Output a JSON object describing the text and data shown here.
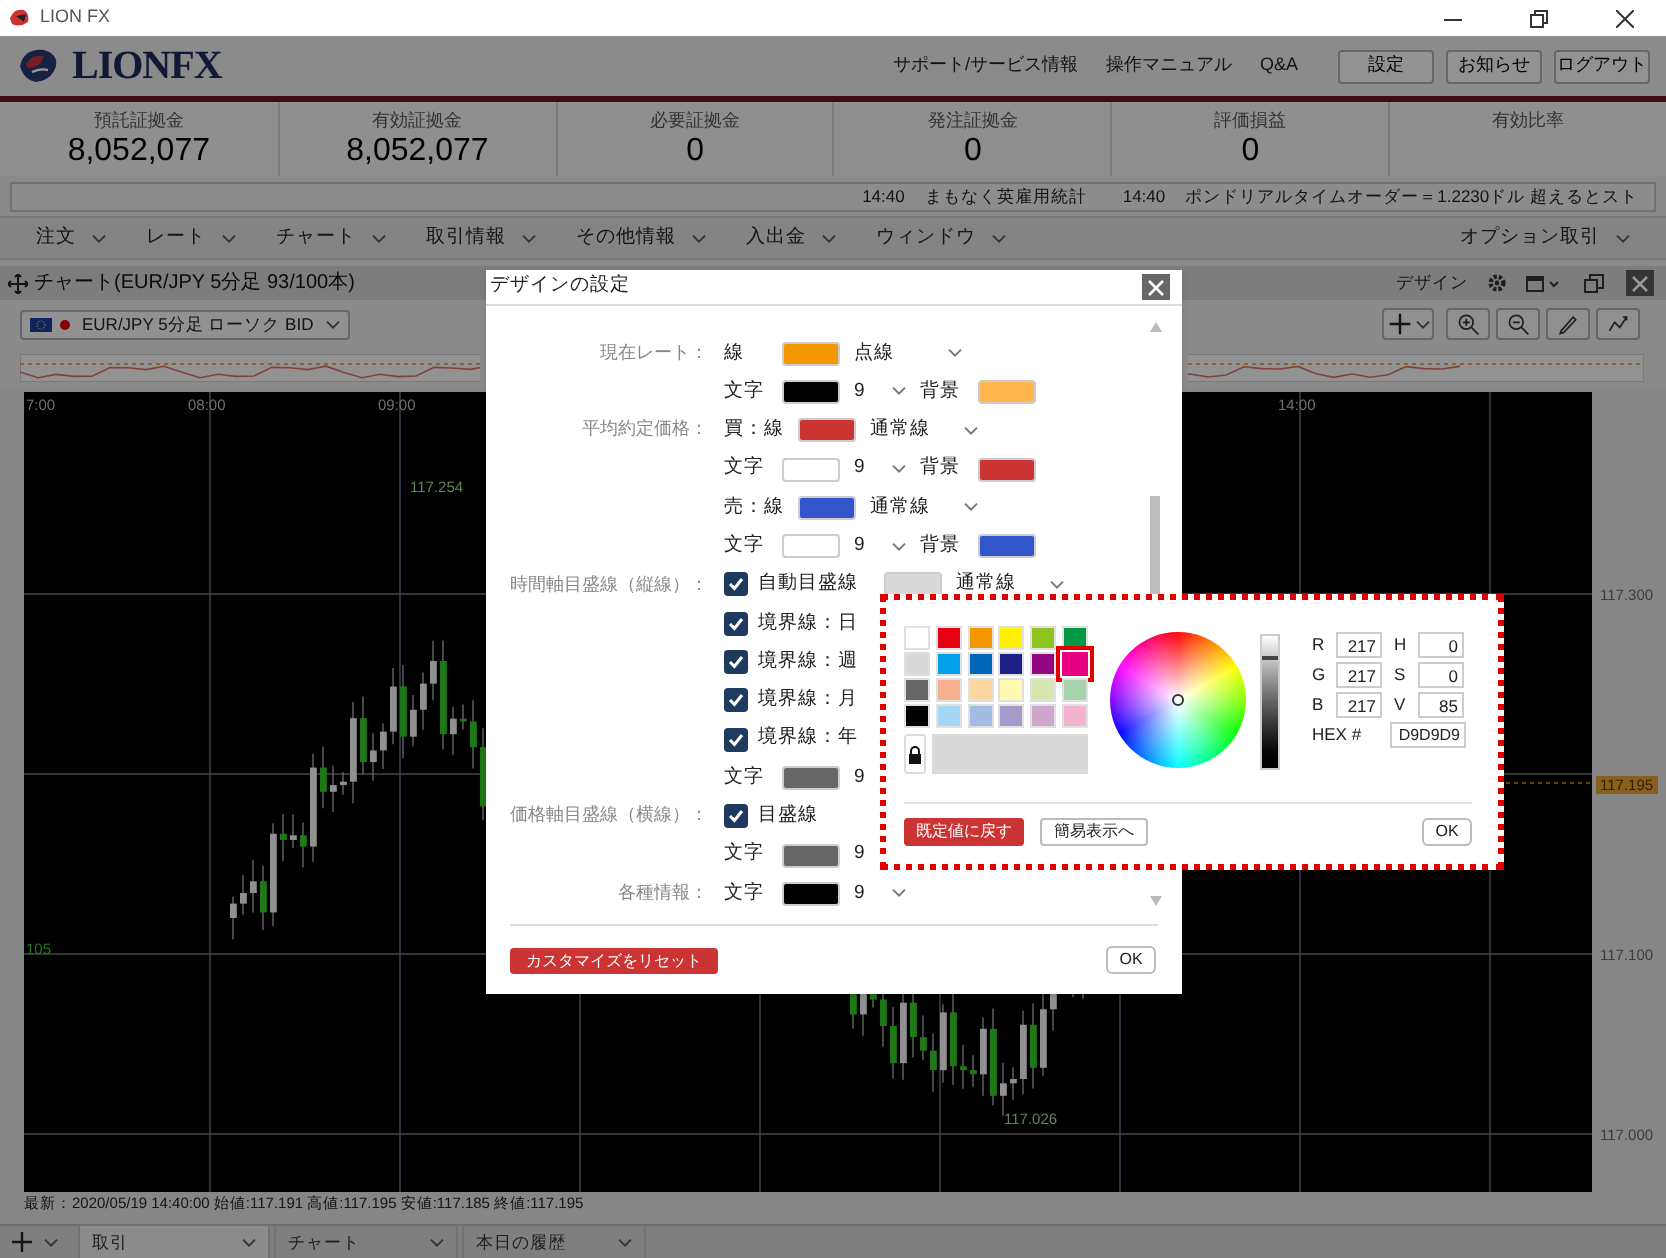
{
  "window": {
    "title": "LION FX"
  },
  "header": {
    "logo": "LIONFX",
    "links": [
      "サポート/サービス情報",
      "操作マニュアル",
      "Q&A"
    ],
    "buttons": [
      "設定",
      "お知らせ",
      "ログアウト"
    ]
  },
  "account_summary": [
    {
      "label": "預託証拠金",
      "value": "8,052,077"
    },
    {
      "label": "有効証拠金",
      "value": "8,052,077"
    },
    {
      "label": "必要証拠金",
      "value": "0"
    },
    {
      "label": "発注証拠金",
      "value": "0"
    },
    {
      "label": "評価損益",
      "value": "0"
    },
    {
      "label": "有効比率"
    }
  ],
  "ticker": [
    {
      "time": "14:40",
      "text": "まもなく英雇用統計"
    },
    {
      "time": "14:40",
      "text": "ポンドリアルタイムオーダー＝1.2230ドル 超えるとスト"
    }
  ],
  "menu": [
    "注文",
    "レート",
    "チャート",
    "取引情報",
    "その他情報",
    "入出金",
    "ウィンドウ"
  ],
  "menu_right": "オプション取引",
  "chart_window": {
    "title": "チャート(EUR/JPY 5分足 93/100本)",
    "design_label": "デザイン",
    "symbol_select": "EUR/JPY 5分足 ローソク BID",
    "time_labels": [
      "7:00",
      "08:00",
      "09:00",
      "14:00"
    ],
    "price_labels": [
      "117.300",
      "117.100",
      "117.000"
    ],
    "current_price": "117.195",
    "candle_labels": [
      "117.254",
      "117.026",
      "105"
    ],
    "status": "最新：2020/05/19 14:40:00 始値:117.191 高値:117.195 安値:117.185 終値:117.195"
  },
  "bottom_tabs": [
    {
      "label": "取引",
      "selected": true
    },
    {
      "label": "チャート",
      "selected": false
    },
    {
      "label": "本日の履歴",
      "selected": false
    }
  ],
  "dialog": {
    "title": "デザインの設定",
    "sections": [
      {
        "label": "現在レート：",
        "rows": [
          [
            {
              "kind": "text",
              "text": "線"
            },
            {
              "kind": "swatch",
              "color": "#f39800"
            },
            {
              "kind": "select",
              "value": "点線"
            }
          ],
          [
            {
              "kind": "text",
              "text": "文字"
            },
            {
              "kind": "swatch",
              "color": "#000000"
            },
            {
              "kind": "select",
              "value": "9"
            },
            {
              "kind": "text",
              "text": "背景"
            },
            {
              "kind": "swatch",
              "color": "#ffb74d"
            }
          ]
        ]
      },
      {
        "label": "平均約定価格：",
        "rows": [
          [
            {
              "kind": "text",
              "text": "買：線"
            },
            {
              "kind": "swatch",
              "color": "#cc3333"
            },
            {
              "kind": "select",
              "value": "通常線"
            }
          ],
          [
            {
              "kind": "text",
              "text": "文字"
            },
            {
              "kind": "swatch",
              "color": "#ffffff"
            },
            {
              "kind": "select",
              "value": "9"
            },
            {
              "kind": "text",
              "text": "背景"
            },
            {
              "kind": "swatch",
              "color": "#cc3333"
            }
          ],
          [
            {
              "kind": "text",
              "text": "売：線"
            },
            {
              "kind": "swatch",
              "color": "#3355cc"
            },
            {
              "kind": "select",
              "value": "通常線"
            }
          ],
          [
            {
              "kind": "text",
              "text": "文字"
            },
            {
              "kind": "swatch",
              "color": "#ffffff"
            },
            {
              "kind": "select",
              "value": "9"
            },
            {
              "kind": "text",
              "text": "背景"
            },
            {
              "kind": "swatch",
              "color": "#3355cc"
            }
          ]
        ]
      },
      {
        "label": "時間軸目盛線（縦線）：",
        "rows": [
          [
            {
              "kind": "checkbox",
              "checked": true,
              "text": "自動目盛線"
            },
            {
              "kind": "swatch",
              "color": "#d9d9d9"
            },
            {
              "kind": "select",
              "value": "通常線"
            }
          ],
          [
            {
              "kind": "checkbox",
              "checked": true,
              "text": "境界線：日"
            }
          ],
          [
            {
              "kind": "checkbox",
              "checked": true,
              "text": "境界線：週"
            }
          ],
          [
            {
              "kind": "checkbox",
              "checked": true,
              "text": "境界線：月"
            }
          ],
          [
            {
              "kind": "checkbox",
              "checked": true,
              "text": "境界線：年"
            }
          ],
          [
            {
              "kind": "text",
              "text": "文字"
            },
            {
              "kind": "swatch",
              "color": "#666666"
            },
            {
              "kind": "select",
              "value": "9"
            }
          ]
        ]
      },
      {
        "label": "価格軸目盛線（横線）：",
        "rows": [
          [
            {
              "kind": "checkbox",
              "checked": true,
              "text": "目盛線"
            }
          ],
          [
            {
              "kind": "text",
              "text": "文字"
            },
            {
              "kind": "swatch",
              "color": "#666666"
            },
            {
              "kind": "select",
              "value": "9"
            }
          ]
        ]
      },
      {
        "label": "各種情報：",
        "rows": [
          [
            {
              "kind": "text",
              "text": "文字"
            },
            {
              "kind": "swatch",
              "color": "#000000"
            },
            {
              "kind": "select",
              "value": "9"
            }
          ]
        ]
      }
    ],
    "reset_button": "カスタマイズをリセット",
    "ok_button": "OK"
  },
  "color_picker": {
    "swatches": [
      {
        "color": "#ffffff",
        "selected": false
      },
      {
        "color": "#e60012",
        "selected": false
      },
      {
        "color": "#f39800",
        "selected": false
      },
      {
        "color": "#fff100",
        "selected": false
      },
      {
        "color": "#8fc31f",
        "selected": false
      },
      {
        "color": "#009944",
        "selected": false
      },
      {
        "color": "#d9d9d9",
        "selected": false
      },
      {
        "color": "#00a0e9",
        "selected": false
      },
      {
        "color": "#0068b7",
        "selected": false
      },
      {
        "color": "#1d2088",
        "selected": false
      },
      {
        "color": "#920783",
        "selected": false
      },
      {
        "color": "#e4007f",
        "selected": true
      },
      {
        "color": "#666666",
        "selected": false
      },
      {
        "color": "#f5b090",
        "selected": false
      },
      {
        "color": "#fcd7a1",
        "selected": false
      },
      {
        "color": "#fff9b1",
        "selected": false
      },
      {
        "color": "#d7e7af",
        "selected": false
      },
      {
        "color": "#a5d4ad",
        "selected": false
      },
      {
        "color": "#000000",
        "selected": false
      },
      {
        "color": "#a3d7f4",
        "selected": false
      },
      {
        "color": "#a3bce2",
        "selected": false
      },
      {
        "color": "#a59aca",
        "selected": false
      },
      {
        "color": "#cfa7cd",
        "selected": false
      },
      {
        "color": "#f4b4d0",
        "selected": false
      }
    ],
    "fields": [
      {
        "label": "R",
        "value": "217"
      },
      {
        "label": "H",
        "value": "0"
      },
      {
        "label": "G",
        "value": "217"
      },
      {
        "label": "S",
        "value": "0"
      },
      {
        "label": "B",
        "value": "217"
      },
      {
        "label": "V",
        "value": "85"
      }
    ],
    "brightness": {
      "level": 0.85
    },
    "hex_label": "HEX #",
    "hex": "D9D9D9",
    "default_button": "既定値に戻す",
    "simple_button": "簡易表示へ",
    "ok_button": "OK"
  }
}
